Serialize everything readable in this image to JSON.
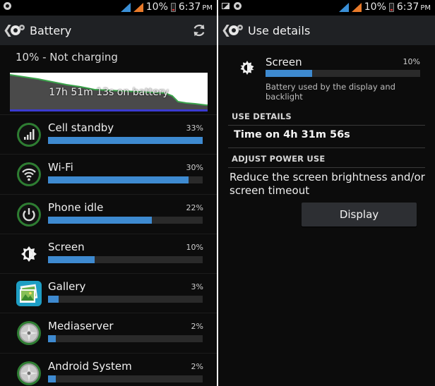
{
  "left_screen": {
    "status": {
      "battery": "10%",
      "time": "6:37",
      "ampm": "PM"
    },
    "title": "Battery",
    "charge_status": "10% - Not charging",
    "graph_label": "17h 51m 13s on battery",
    "items": [
      {
        "label": "Cell standby",
        "percent": "33%",
        "fraction": 1.0,
        "icon": "cell-standby-icon"
      },
      {
        "label": "Wi-Fi",
        "percent": "30%",
        "fraction": 0.91,
        "icon": "wifi-icon"
      },
      {
        "label": "Phone idle",
        "percent": "22%",
        "fraction": 0.67,
        "icon": "power-icon"
      },
      {
        "label": "Screen",
        "percent": "10%",
        "fraction": 0.3,
        "icon": "brightness-icon"
      },
      {
        "label": "Gallery",
        "percent": "3%",
        "fraction": 0.07,
        "icon": "gallery-icon"
      },
      {
        "label": "Mediaserver",
        "percent": "2%",
        "fraction": 0.05,
        "icon": "mediaserver-icon"
      },
      {
        "label": "Android System",
        "percent": "2%",
        "fraction": 0.05,
        "icon": "android-system-icon"
      }
    ]
  },
  "right_screen": {
    "status": {
      "battery": "10%",
      "time": "6:37",
      "ampm": "PM"
    },
    "title": "Use details",
    "detail": {
      "name": "Screen",
      "percent": "10%",
      "fraction": 0.3,
      "description": "Battery used by the display and backlight"
    },
    "use_details_header": "USE DETAILS",
    "time_on": "Time on 4h 31m 56s",
    "adjust_header": "ADJUST POWER USE",
    "reduce_text": "Reduce the screen brightness and/or screen timeout",
    "display_button": "Display"
  },
  "colors": {
    "accent_blue": "#3e8ad0",
    "background": "#0c0c0c",
    "graph_green": "#3aa34a"
  }
}
